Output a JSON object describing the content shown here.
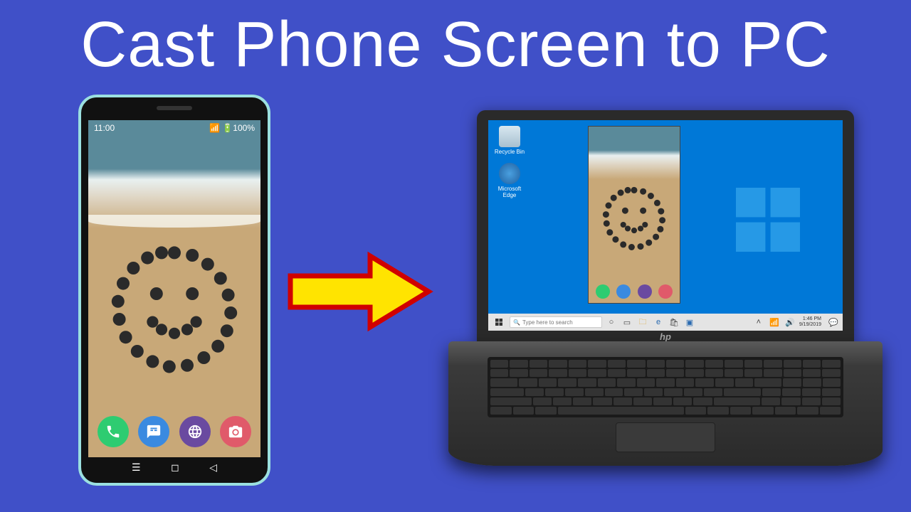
{
  "title": "Cast Phone Screen to PC",
  "phone": {
    "status_time": "11:00",
    "status_battery": "100%",
    "dock": {
      "phone_label": "phone",
      "messages_label": "messages",
      "browser_label": "browser",
      "camera_label": "camera"
    }
  },
  "laptop": {
    "brand": "hp",
    "desktop": {
      "icon1_label": "Recycle Bin",
      "icon2_label": "Microsoft Edge"
    },
    "taskbar": {
      "search_placeholder": "Type here to search",
      "clock_time": "1:46 PM",
      "clock_date": "9/19/2019"
    }
  }
}
